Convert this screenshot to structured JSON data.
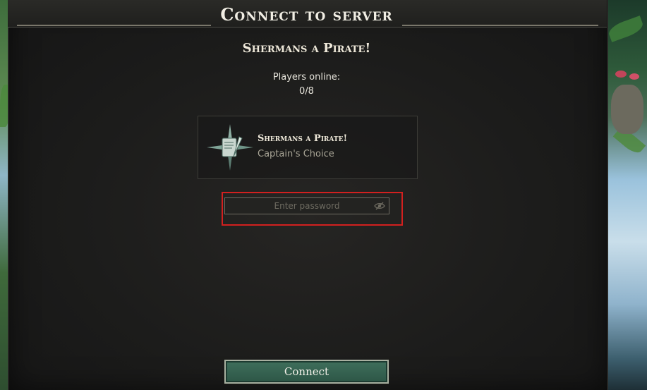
{
  "dialog": {
    "title": "Connect to server",
    "server_name": "Shermans a Pirate!",
    "players_label": "Players online:",
    "players_count": "0/8"
  },
  "server_card": {
    "name": "Shermans a Pirate!",
    "subtitle": "Captain's Choice",
    "emblem_icon": "compass-quill-icon"
  },
  "password": {
    "placeholder": "Enter password",
    "value": "",
    "toggle_icon": "eye-slash-icon"
  },
  "actions": {
    "connect_label": "Connect"
  },
  "colors": {
    "accent": "#2d5646",
    "highlight": "#d2201f"
  }
}
